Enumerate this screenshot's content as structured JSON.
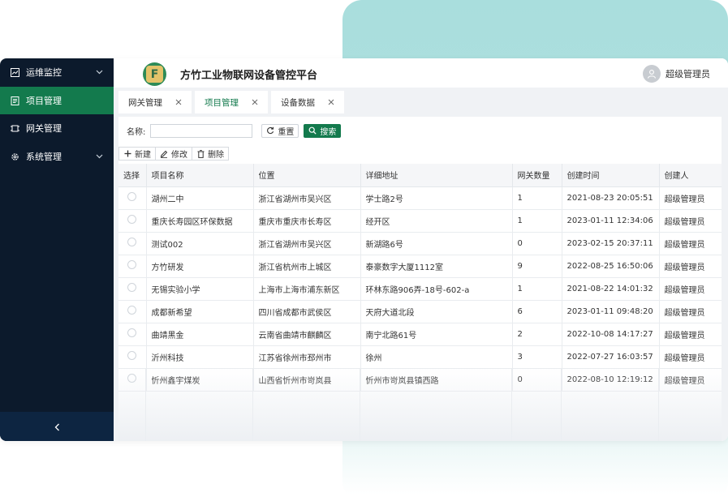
{
  "app": {
    "title": "方竹工业物联网设备管控平台",
    "logo_letter": "F",
    "user_name": "超级管理员"
  },
  "sidebar": {
    "items": [
      {
        "label": "运维监控",
        "icon": "chart-icon",
        "has_children": true,
        "active": false
      },
      {
        "label": "项目管理",
        "icon": "document-icon",
        "has_children": false,
        "active": true
      },
      {
        "label": "网关管理",
        "icon": "gateway-icon",
        "has_children": false,
        "active": false
      },
      {
        "label": "系统管理",
        "icon": "gear-icon",
        "has_children": true,
        "active": false
      }
    ],
    "collapse_icon": "chevron-left-icon"
  },
  "tabs": [
    {
      "label": "网关管理",
      "active": false
    },
    {
      "label": "项目管理",
      "active": true
    },
    {
      "label": "设备数据",
      "active": false
    }
  ],
  "search": {
    "label": "名称:",
    "value": "",
    "placeholder": "",
    "reset_label": "重置",
    "search_label": "搜索"
  },
  "toolbar": {
    "new_label": "新建",
    "edit_label": "修改",
    "delete_label": "删除"
  },
  "table": {
    "columns": [
      "选择",
      "项目名称",
      "位置",
      "详细地址",
      "网关数量",
      "创建时间",
      "创建人"
    ],
    "rows": [
      {
        "name": "湖州二中",
        "location": "浙江省湖州市吴兴区",
        "address": "学士路2号",
        "gateways": "1",
        "created": "2021-08-23 20:05:51",
        "creator": "超级管理员"
      },
      {
        "name": "重庆长寿园区环保数据",
        "location": "重庆市重庆市长寿区",
        "address": "经开区",
        "gateways": "1",
        "created": "2023-01-11 12:34:06",
        "creator": "超级管理员"
      },
      {
        "name": "测试002",
        "location": "浙江省湖州市吴兴区",
        "address": "新湖路6号",
        "gateways": "0",
        "created": "2023-02-15 20:37:11",
        "creator": "超级管理员"
      },
      {
        "name": "方竹研发",
        "location": "浙江省杭州市上城区",
        "address": "泰豪数字大厦1112室",
        "gateways": "9",
        "created": "2022-08-25 16:50:06",
        "creator": "超级管理员"
      },
      {
        "name": "无锡实验小学",
        "location": "上海市上海市浦东新区",
        "address": "环林东路906弄-18号-602-a",
        "gateways": "1",
        "created": "2021-08-22 14:01:32",
        "creator": "超级管理员"
      },
      {
        "name": "成都新希望",
        "location": "四川省成都市武侯区",
        "address": "天府大道北段",
        "gateways": "6",
        "created": "2023-01-11 09:48:20",
        "creator": "超级管理员"
      },
      {
        "name": "曲靖黑金",
        "location": "云南省曲靖市麒麟区",
        "address": "南宁北路61号",
        "gateways": "2",
        "created": "2022-10-08 14:17:27",
        "creator": "超级管理员"
      },
      {
        "name": "沂州科技",
        "location": "江苏省徐州市邳州市",
        "address": "徐州",
        "gateways": "3",
        "created": "2022-07-27 16:03:57",
        "creator": "超级管理员"
      },
      {
        "name": "忻州鑫宇煤炭",
        "location": "山西省忻州市岢岚县",
        "address": "忻州市岢岚县镇西路",
        "gateways": "0",
        "created": "2022-08-10 12:19:12",
        "creator": "超级管理员"
      }
    ]
  },
  "colors": {
    "sidebar_bg": "#0c1a2c",
    "accent": "#137a4d",
    "decor_teal": "#a9dedd"
  }
}
